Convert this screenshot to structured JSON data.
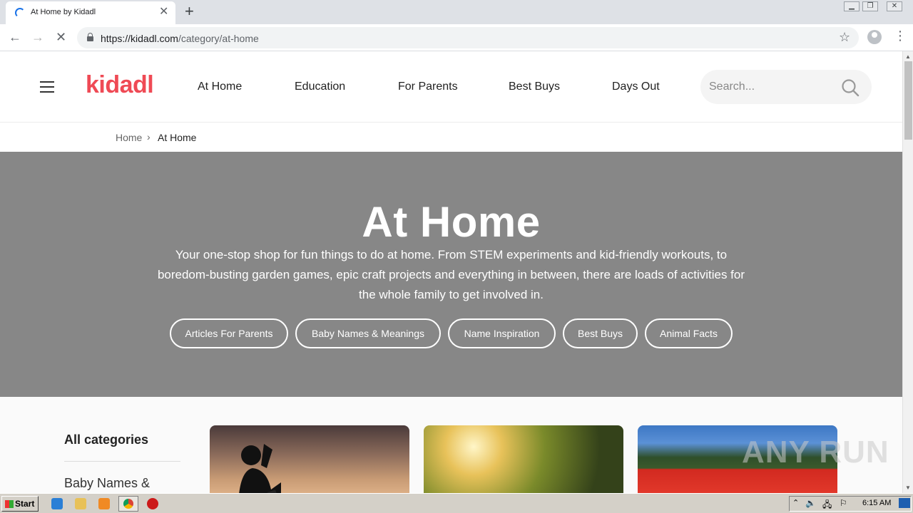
{
  "browser": {
    "tab_title": "At Home by Kidadl",
    "tab_close": "✕",
    "new_tab": "+",
    "url_host": "https://kidadl.com",
    "url_path": "/category/at-home",
    "back_icon": "←",
    "forward_icon": "→",
    "reload_icon": "✕",
    "star_icon": "☆",
    "menu_icon": "⋮"
  },
  "header": {
    "logo": "kidadl",
    "nav": [
      "At Home",
      "Education",
      "For Parents",
      "Best Buys",
      "Days Out"
    ],
    "search_placeholder": "Search..."
  },
  "breadcrumb": {
    "home": "Home",
    "separator": "›",
    "current": "At Home"
  },
  "hero": {
    "title": "At Home",
    "description": "Your one-stop shop for fun things to do at home. From STEM experiments and kid-friendly workouts, to boredom-busting garden games, epic craft projects and everything in between, there are loads of activities for the whole family to get involved in.",
    "chips": [
      "Articles For Parents",
      "Baby Names & Meanings",
      "Name Inspiration",
      "Best Buys",
      "Animal Facts"
    ]
  },
  "sidebar": {
    "heading": "All categories",
    "first_item": "Baby Names &"
  },
  "watermark": "ANY RUN",
  "taskbar": {
    "start": "Start",
    "clock": "6:15 AM"
  },
  "colors": {
    "brand": "#ef4a55",
    "hero_bg": "#878787"
  }
}
